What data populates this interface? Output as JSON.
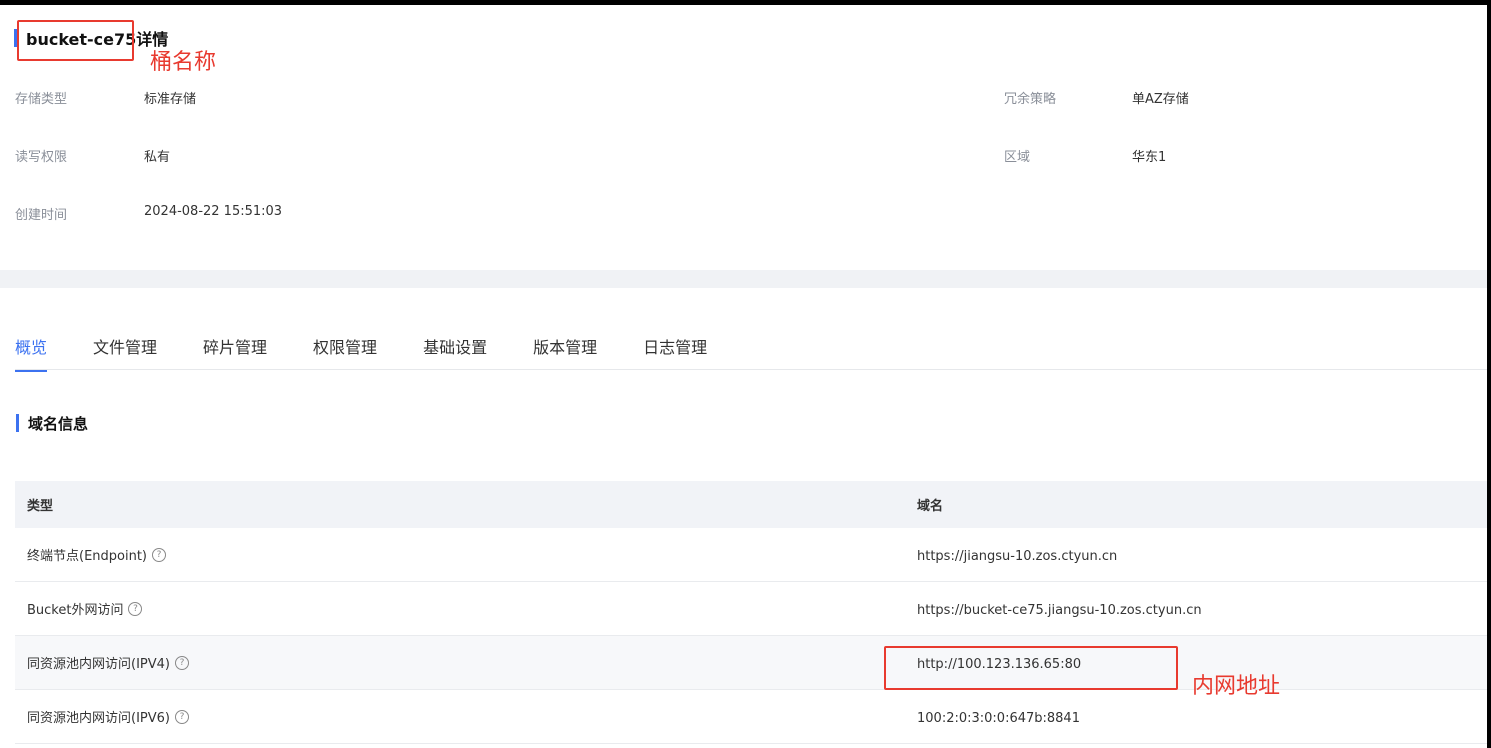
{
  "header": {
    "title": "bucket-ce75详情",
    "annotation": "桶名称"
  },
  "info": {
    "storage_type_label": "存储类型",
    "storage_type_value": "标准存储",
    "redundancy_label": "冗余策略",
    "redundancy_value": "单AZ存储",
    "permission_label": "读写权限",
    "permission_value": "私有",
    "region_label": "区域",
    "region_value": "华东1",
    "created_label": "创建时间",
    "created_value": "2024-08-22 15:51:03"
  },
  "tabs": [
    {
      "label": "概览",
      "active": true
    },
    {
      "label": "文件管理"
    },
    {
      "label": "碎片管理"
    },
    {
      "label": "权限管理"
    },
    {
      "label": "基础设置"
    },
    {
      "label": "版本管理"
    },
    {
      "label": "日志管理"
    }
  ],
  "section": {
    "title": "域名信息"
  },
  "table": {
    "headers": [
      "类型",
      "域名"
    ],
    "rows": [
      {
        "type": "终端节点(Endpoint)",
        "domain": "https://jiangsu-10.zos.ctyun.cn"
      },
      {
        "type": "Bucket外网访问",
        "domain": "https://bucket-ce75.jiangsu-10.zos.ctyun.cn"
      },
      {
        "type": "同资源池内网访问(IPV4)",
        "domain": "http://100.123.136.65:80"
      },
      {
        "type": "同资源池内网访问(IPV6)",
        "domain": "100:2:0:3:0:0:647b:8841"
      }
    ],
    "annotation": "内网地址"
  },
  "icons": {
    "help": "help-circle-icon"
  },
  "colors": {
    "accent": "#3c72f0",
    "annotation": "#e83a2f"
  }
}
